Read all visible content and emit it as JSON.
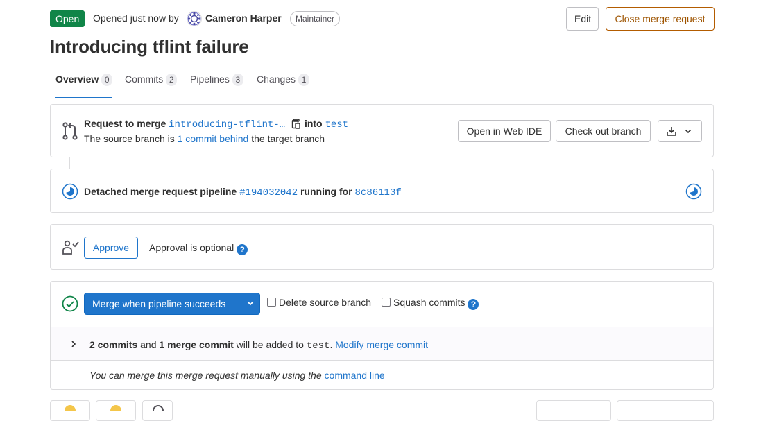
{
  "header": {
    "status": "Open",
    "opened_text": "Opened just now by",
    "author": "Cameron Harper",
    "role": "Maintainer",
    "edit_label": "Edit",
    "close_label": "Close merge request"
  },
  "title": "Introducing tflint failure",
  "tabs": [
    {
      "label": "Overview",
      "count": "0"
    },
    {
      "label": "Commits",
      "count": "2"
    },
    {
      "label": "Pipelines",
      "count": "3"
    },
    {
      "label": "Changes",
      "count": "1"
    }
  ],
  "merge_request": {
    "request_prefix": "Request to merge",
    "source_branch": "introducing-tflint-…",
    "into_text": "into",
    "target_branch": "test",
    "behind_prefix": "The source branch is",
    "behind_link": "1 commit behind",
    "behind_suffix": "the target branch",
    "open_web_ide": "Open in Web IDE",
    "check_out_branch": "Check out branch"
  },
  "pipeline": {
    "prefix": "Detached merge request pipeline",
    "id": "#194032042",
    "middle": "running for",
    "commit": "8c86113f"
  },
  "approval": {
    "approve_label": "Approve",
    "optional_text": "Approval is optional",
    "help_glyph": "?"
  },
  "merge": {
    "button_label": "Merge when pipeline succeeds",
    "delete_source": "Delete source branch",
    "squash": "Squash commits",
    "help_glyph": "?",
    "commits_count": "2 commits",
    "and_text": "and",
    "merge_commit": "1 merge commit",
    "will_be_added": "will be added to",
    "target": "test",
    "period": ".",
    "modify_link": "Modify merge commit",
    "manual_text": "You can merge this merge request manually using the",
    "command_line_link": "command line"
  },
  "colors": {
    "open_badge": "#108548",
    "link": "#1f75cb",
    "primary": "#1f75cb",
    "close_button": "#9e5400"
  },
  "icons": {
    "merge_request": "merge-request-icon",
    "copy": "copy-icon",
    "download": "download-icon",
    "pipeline_running": "status-running-icon",
    "approval": "approval-icon",
    "success": "check-circle-icon",
    "chevron": "chevron-down-icon",
    "expand": "chevron-right-icon"
  }
}
